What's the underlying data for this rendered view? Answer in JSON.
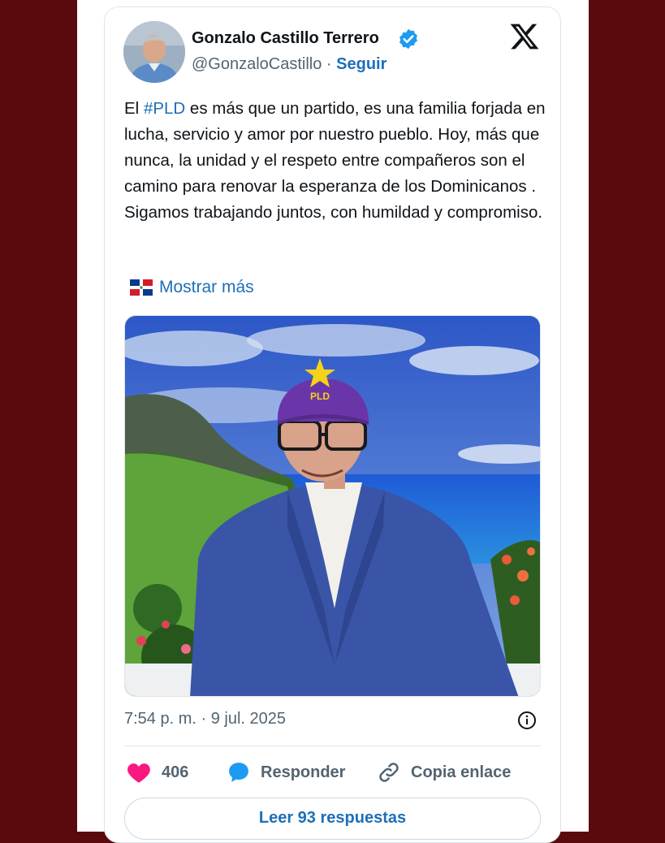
{
  "author": {
    "name": "Gonzalo Castillo Terrero",
    "handle": "@GonzaloCastillo",
    "separator": " · ",
    "follow_label": "Seguir"
  },
  "tweet": {
    "text_before": "El ",
    "hashtag": "#PLD",
    "text_after": " es más que un partido, es una familia forjada en lucha, servicio y amor por nuestro pueblo. Hoy, más que nunca, la unidad y el respeto entre compañeros son el camino para renovar la esperanza de los Dominicanos . Sigamos trabajando juntos, con humildad y compromiso.",
    "show_more": "Mostrar más",
    "cap_text": "PLD",
    "timestamp": "7:54 p. m. · 9 jul. 2025"
  },
  "actions": {
    "likes": "406",
    "reply_label": "Responder",
    "copy_label": "Copia enlace",
    "read_replies": "Leer 93 respuestas"
  },
  "colors": {
    "accent": "#1d6fb8",
    "like": "#f91880",
    "reply": "#1d9bf0",
    "frame": "#5a0a0d"
  },
  "icons": [
    "verified-badge-icon",
    "x-logo-icon",
    "dominican-flag-icon",
    "info-icon",
    "heart-icon",
    "speech-bubble-icon",
    "link-icon"
  ]
}
